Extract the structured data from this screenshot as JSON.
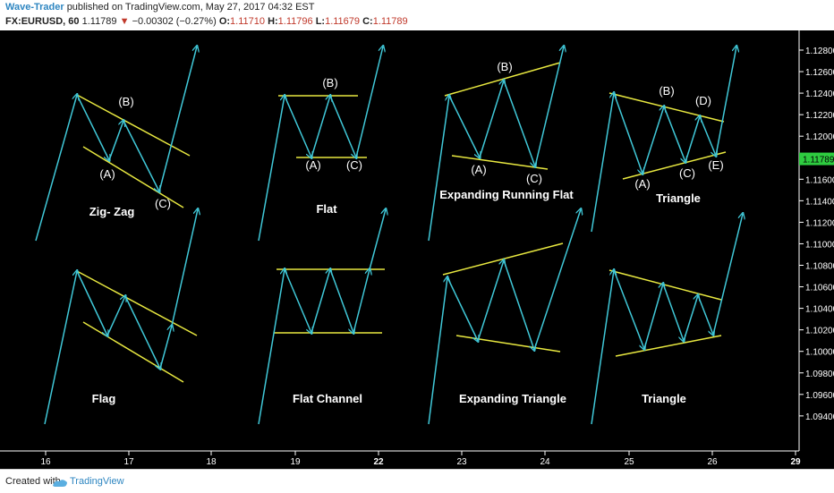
{
  "header": {
    "author": "Wave-Trader",
    "published_text": "published on TradingView.com, May 27, 2017 04:32 EST",
    "symbol": "FX:EURUSD, 60",
    "last": "1.11789",
    "change": "−0.00302 (−0.27%)",
    "o_label": "O:",
    "o_val": "1.11710",
    "h_label": "H:",
    "h_val": "1.11796",
    "l_label": "L:",
    "l_val": "1.11679",
    "c_label": "C:",
    "c_val": "1.11789"
  },
  "footer": {
    "created_with": "Created with",
    "brand": "TradingView"
  },
  "colors": {
    "background": "#000000",
    "wave": "#40c8d8",
    "boundary": "#e8e840",
    "current_price": "#2ecc40",
    "text": "#ffffff"
  },
  "chart_data": {
    "type": "line",
    "price_axis": {
      "ticks": [
        "1.12800",
        "1.12600",
        "1.12400",
        "1.12200",
        "1.12000",
        "1.11800",
        "1.11600",
        "1.11400",
        "1.11200",
        "1.11000",
        "1.10800",
        "1.10600",
        "1.10400",
        "1.10200",
        "1.10000",
        "1.09800",
        "1.09600",
        "1.09400"
      ],
      "current_price": "1.11789",
      "ylim": [
        1.0935,
        1.1295
      ]
    },
    "time_axis": {
      "ticks": [
        {
          "label": "16",
          "bold": false
        },
        {
          "label": "17",
          "bold": false
        },
        {
          "label": "18",
          "bold": false
        },
        {
          "label": "19",
          "bold": false
        },
        {
          "label": "22",
          "bold": true
        },
        {
          "label": "23",
          "bold": false
        },
        {
          "label": "24",
          "bold": false
        },
        {
          "label": "25",
          "bold": false
        },
        {
          "label": "26",
          "bold": false
        },
        {
          "label": "29",
          "bold": true
        }
      ]
    },
    "patterns": [
      {
        "name": "Zig- Zag",
        "wave_labels": [
          "(A)",
          "(B)",
          "(C)"
        ]
      },
      {
        "name": "Flat",
        "wave_labels": [
          "(A)",
          "(B)",
          "(C)"
        ]
      },
      {
        "name": "Expanding Running Flat",
        "wave_labels": [
          "(A)",
          "(B)",
          "(C)"
        ]
      },
      {
        "name": "Triangle",
        "wave_labels": [
          "(A)",
          "(B)",
          "(C)",
          "(D)",
          "(E)"
        ]
      },
      {
        "name": "Flag",
        "wave_labels": []
      },
      {
        "name": "Flat Channel",
        "wave_labels": []
      },
      {
        "name": "Expanding Triangle",
        "wave_labels": []
      },
      {
        "name": "Triangle",
        "wave_labels": []
      }
    ]
  }
}
